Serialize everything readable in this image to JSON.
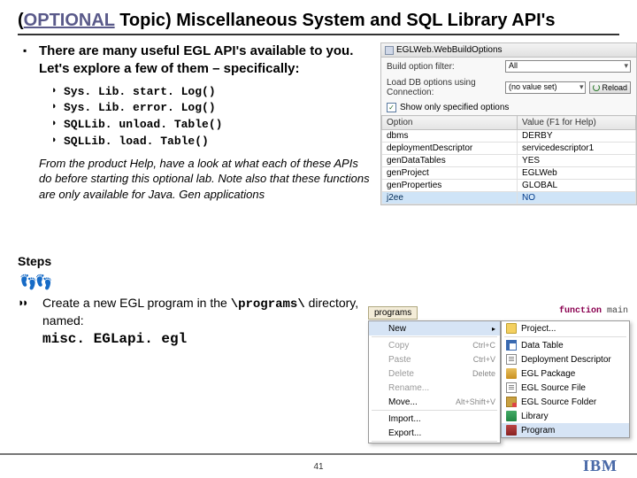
{
  "title": {
    "prefix": "(",
    "optional": "OPTIONAL",
    "rest": " Topic) Miscellaneous System and SQL Library API's"
  },
  "intro": "There are many useful EGL API's available to you. Let's explore a few of them – specifically:",
  "apis": [
    "Sys. Lib. start. Log()",
    "Sys. Lib. error. Log()",
    "SQLLib. unload. Table()",
    "SQLLib. load. Table()"
  ],
  "help_note": "From the product Help, have a look at what each of these APIs do before starting this optional lab.  Note also that these functions are only available for Java. Gen applications",
  "steps": {
    "label": "Steps",
    "line1_a": "Create a new EGL program in the ",
    "line1_code": "\\programs\\",
    "line1_b": " directory, named:",
    "filename": "misc. EGLapi. egl"
  },
  "panel": {
    "title": "EGLWeb.WebBuildOptions",
    "row1_label": "Build option filter:",
    "row1_value": "All",
    "row2_label": "Load DB options using Connection:",
    "row2_value": "(no value set)",
    "reload": "Reload",
    "checkbox": "Show only specified options",
    "col1": "Option",
    "col2": "Value (F1 for Help)",
    "rows": [
      [
        "dbms",
        "DERBY"
      ],
      [
        "deploymentDescriptor",
        "servicedescriptor1"
      ],
      [
        "genDataTables",
        "YES"
      ],
      [
        "genProject",
        "EGLWeb"
      ],
      [
        "genProperties",
        "GLOBAL"
      ],
      [
        "j2ee",
        "NO"
      ]
    ]
  },
  "ctx": {
    "tab": "programs",
    "code_kw": "function",
    "code_rest": "  main",
    "menu": [
      {
        "label": "New",
        "sel": true,
        "arrow": true
      },
      {
        "sep": true
      },
      {
        "label": "Copy",
        "hot": "Ctrl+C",
        "disabled": true
      },
      {
        "label": "Paste",
        "hot": "Ctrl+V",
        "disabled": true
      },
      {
        "label": "Delete",
        "hot": "Delete",
        "disabled": true
      },
      {
        "label": "Rename...",
        "disabled": true
      },
      {
        "label": "Move...",
        "hot": "Alt+Shift+V"
      },
      {
        "sep": true
      },
      {
        "label": "Import..."
      },
      {
        "label": "Export..."
      },
      {
        "sep": true
      }
    ],
    "submenu": [
      {
        "label": "Project...",
        "ic": "i-folder"
      },
      {
        "sep": true
      },
      {
        "label": "Data Table",
        "ic": "i-grid"
      },
      {
        "label": "Deployment Descriptor",
        "ic": "i-doc"
      },
      {
        "label": "EGL Package",
        "ic": "i-pkg"
      },
      {
        "label": "EGL Source File",
        "ic": "i-doc"
      },
      {
        "label": "EGL Source Folder",
        "ic": "i-srcf"
      },
      {
        "label": "Library",
        "ic": "i-lib"
      },
      {
        "label": "Program",
        "ic": "i-prog",
        "sel": true
      }
    ]
  },
  "page": "41",
  "logo": "IBM"
}
